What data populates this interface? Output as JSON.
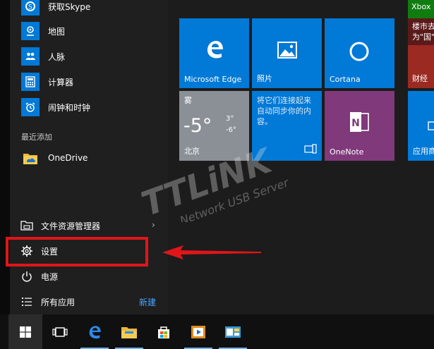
{
  "app_list": [
    {
      "label": "获取Skype",
      "icon": "skype-icon"
    },
    {
      "label": "地图",
      "icon": "maps-icon"
    },
    {
      "label": "人脉",
      "icon": "people-icon"
    },
    {
      "label": "计算器",
      "icon": "calculator-icon"
    },
    {
      "label": "闹钟和时钟",
      "icon": "alarm-clock-icon"
    }
  ],
  "recently_added": {
    "label": "最近添加",
    "items": [
      {
        "label": "OneDrive",
        "icon": "onedrive-folder-icon"
      }
    ]
  },
  "system_items": {
    "file_explorer": "文件资源管理器",
    "settings": "设置",
    "power": "电源",
    "all_apps": "所有应用",
    "new_label": "新建"
  },
  "tiles": {
    "edge": "Microsoft Edge",
    "photos": "照片",
    "cortana": "Cortana",
    "weather": {
      "city": "北京",
      "temp": "-5°",
      "high": "3°",
      "low": "-6°",
      "condition": "雾"
    },
    "pin_phone": "将它们连接起来 自动同步你的内容。",
    "onenote": "OneNote",
    "xbox": "Xbox",
    "news": "楼市去 为\"国\"",
    "finance": "财经",
    "store": "应用商"
  },
  "watermark": {
    "brand": "TTLiNK",
    "tagline": "Network USB Server"
  },
  "colors": {
    "tile_blue": "#0079d7",
    "tile_purple": "#80397b",
    "accent": "#0a78d7",
    "highlight_red": "#e0151a"
  }
}
